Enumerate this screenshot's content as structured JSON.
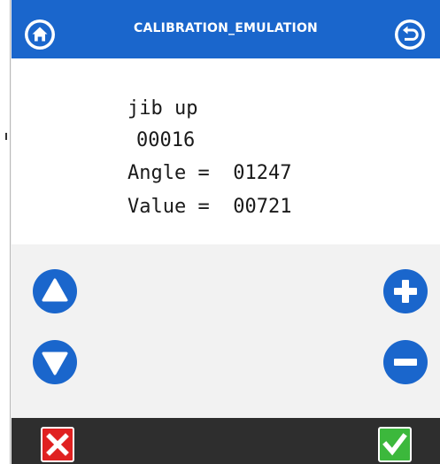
{
  "header": {
    "title": "CALIBRATION_EMULATION",
    "home_icon": "home-icon",
    "back_icon": "return-icon",
    "color": "#1a66cc"
  },
  "display": {
    "mode": "jib up",
    "count": "00016",
    "angle_label": "Angle =",
    "angle_value": "01247",
    "value_label": "Value =",
    "value_value": "00721"
  },
  "controls": {
    "up_icon": "triangle-up-icon",
    "down_icon": "triangle-down-icon",
    "plus_icon": "plus-icon",
    "minus_icon": "minus-icon",
    "accent": "#1a66cc"
  },
  "footer": {
    "cancel_icon": "close-icon",
    "cancel_color": "#e02020",
    "confirm_icon": "check-icon",
    "confirm_color": "#3cb83c"
  }
}
